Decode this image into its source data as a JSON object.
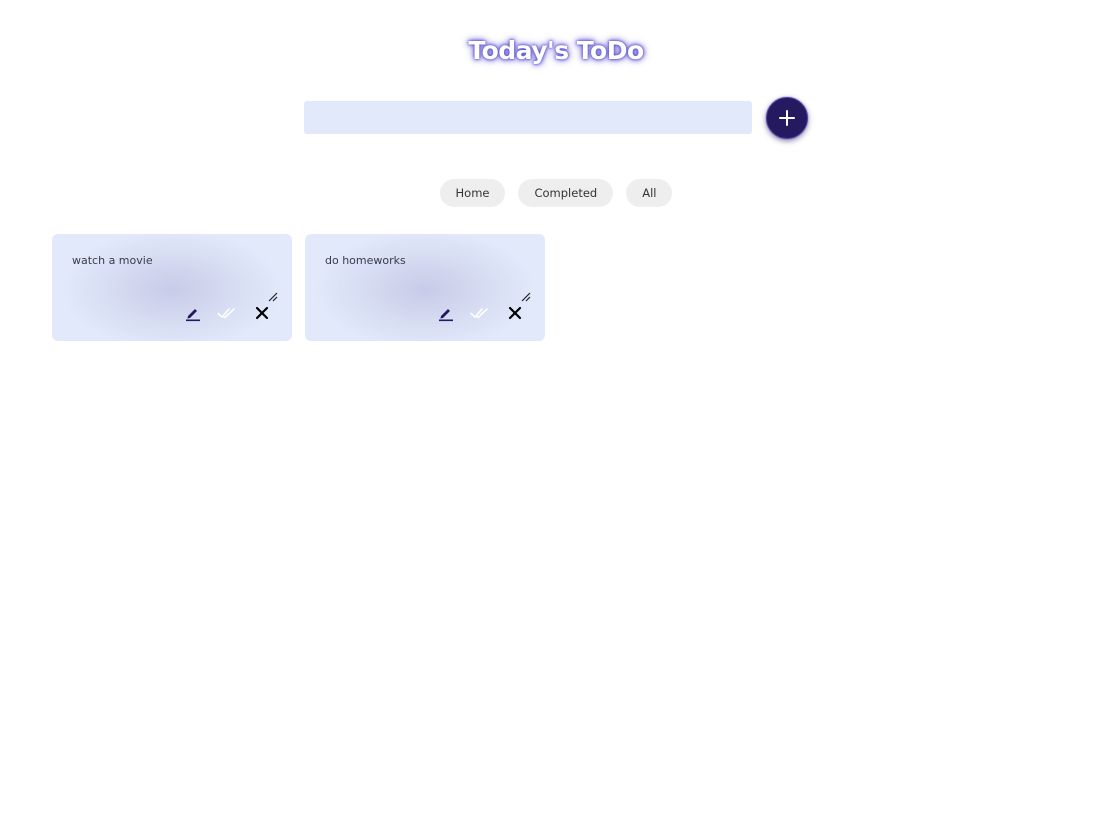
{
  "header": {
    "title": "Today's ToDo"
  },
  "input": {
    "value": "",
    "placeholder": ""
  },
  "add_button": {
    "icon": "plus-icon"
  },
  "filters": [
    {
      "label": "Home"
    },
    {
      "label": "Completed"
    },
    {
      "label": "All"
    }
  ],
  "todos": [
    {
      "text": "watch a movie"
    },
    {
      "text": "do homeworks"
    }
  ],
  "colors": {
    "accent": "#25195f",
    "input_bg": "#e1e9fb",
    "filter_bg": "#eeeeee"
  }
}
